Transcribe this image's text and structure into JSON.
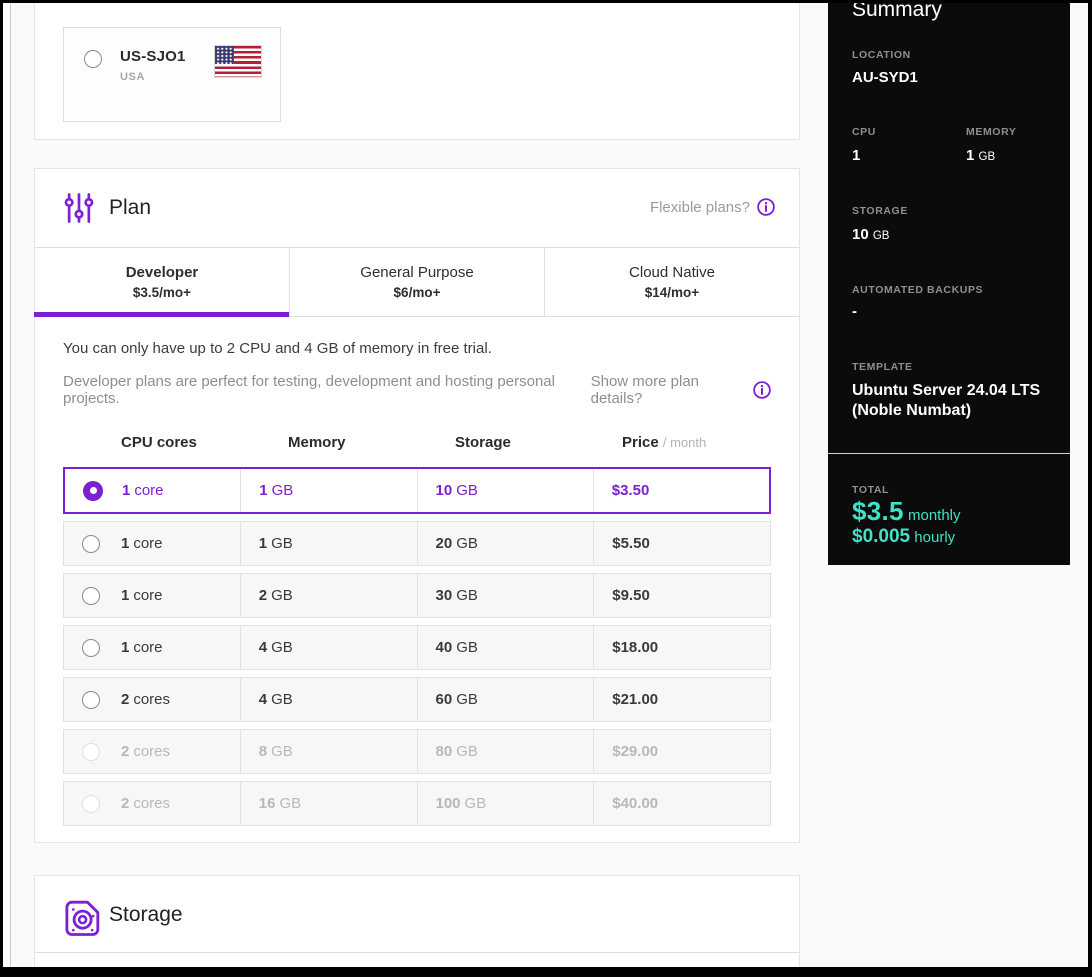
{
  "colors": {
    "accent": "#7d1fd3",
    "teal": "#3fe2c5",
    "panel_bg": "#0b0b0b"
  },
  "location_section": {
    "option": {
      "name": "US-SJO1",
      "country": "USA",
      "flag_icon": "us-flag"
    }
  },
  "plan_section": {
    "title": "Plan",
    "flexible_plans_label": "Flexible plans?",
    "tabs": [
      {
        "name": "Developer",
        "price": "$3.5/mo+"
      },
      {
        "name": "General Purpose",
        "price": "$6/mo+"
      },
      {
        "name": "Cloud Native",
        "price": "$14/mo+"
      }
    ],
    "trial_notice": "You can only have up to 2 CPU and 4 GB of memory in free trial.",
    "plan_description": "Developer plans are perfect for testing, development and hosting personal projects.",
    "more_details_label": "Show more plan details?",
    "table": {
      "headers": {
        "cpu": "CPU cores",
        "memory": "Memory",
        "storage": "Storage",
        "price": "Price",
        "price_suffix": "/ month"
      },
      "rows": [
        {
          "cpu_value": "1",
          "cpu_unit": "core",
          "memory_value": "1",
          "memory_unit": "GB",
          "storage_value": "10",
          "storage_unit": "GB",
          "price": "$3.50",
          "selected": true,
          "disabled": false
        },
        {
          "cpu_value": "1",
          "cpu_unit": "core",
          "memory_value": "1",
          "memory_unit": "GB",
          "storage_value": "20",
          "storage_unit": "GB",
          "price": "$5.50",
          "selected": false,
          "disabled": false
        },
        {
          "cpu_value": "1",
          "cpu_unit": "core",
          "memory_value": "2",
          "memory_unit": "GB",
          "storage_value": "30",
          "storage_unit": "GB",
          "price": "$9.50",
          "selected": false,
          "disabled": false
        },
        {
          "cpu_value": "1",
          "cpu_unit": "core",
          "memory_value": "4",
          "memory_unit": "GB",
          "storage_value": "40",
          "storage_unit": "GB",
          "price": "$18.00",
          "selected": false,
          "disabled": false
        },
        {
          "cpu_value": "2",
          "cpu_unit": "cores",
          "memory_value": "4",
          "memory_unit": "GB",
          "storage_value": "60",
          "storage_unit": "GB",
          "price": "$21.00",
          "selected": false,
          "disabled": false
        },
        {
          "cpu_value": "2",
          "cpu_unit": "cores",
          "memory_value": "8",
          "memory_unit": "GB",
          "storage_value": "80",
          "storage_unit": "GB",
          "price": "$29.00",
          "selected": false,
          "disabled": true
        },
        {
          "cpu_value": "2",
          "cpu_unit": "cores",
          "memory_value": "16",
          "memory_unit": "GB",
          "storage_value": "100",
          "storage_unit": "GB",
          "price": "$40.00",
          "selected": false,
          "disabled": true
        }
      ]
    }
  },
  "storage_section": {
    "title": "Storage"
  },
  "summary_panel": {
    "title": "Summary",
    "location_label": "LOCATION",
    "location_value": "AU-SYD1",
    "cpu_label": "CPU",
    "cpu_value": "1",
    "memory_label": "MEMORY",
    "memory_value": "1",
    "memory_unit": "GB",
    "storage_label": "STORAGE",
    "storage_value": "10",
    "storage_unit": "GB",
    "backups_label": "AUTOMATED BACKUPS",
    "backups_value": "-",
    "template_label": "TEMPLATE",
    "template_value": "Ubuntu Server 24.04 LTS (Noble Numbat)",
    "total_label": "TOTAL",
    "monthly_value": "$3.5",
    "monthly_suffix": "monthly",
    "hourly_value": "$0.005",
    "hourly_suffix": "hourly"
  }
}
